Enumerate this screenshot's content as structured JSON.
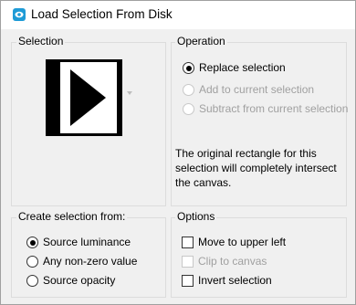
{
  "window": {
    "title": "Load Selection From Disk",
    "icon": "paintshop-app-icon"
  },
  "selection_group": {
    "label": "Selection",
    "thumbnail": "selection-preview-thumbnail"
  },
  "operation_group": {
    "label": "Operation",
    "options": [
      {
        "label": "Replace selection",
        "checked": true,
        "enabled": true
      },
      {
        "label": "Add to current selection",
        "checked": false,
        "enabled": false
      },
      {
        "label": "Subtract from current selection",
        "checked": false,
        "enabled": false
      }
    ],
    "info_text": "The original rectangle for this selection will completely intersect the canvas."
  },
  "create_group": {
    "label": "Create selection from:",
    "options": [
      {
        "label": "Source luminance",
        "checked": true
      },
      {
        "label": "Any non-zero value",
        "checked": false
      },
      {
        "label": "Source opacity",
        "checked": false
      }
    ]
  },
  "options_group": {
    "label": "Options",
    "items": [
      {
        "label": "Move to upper left",
        "checked": false,
        "enabled": true
      },
      {
        "label": "Clip to canvas",
        "checked": false,
        "enabled": false
      },
      {
        "label": "Invert selection",
        "checked": false,
        "enabled": true
      }
    ]
  },
  "colors": {
    "icon_teal": "#1e9bd6",
    "group_border": "#dcdcdc",
    "disabled_text": "#a0a0a0"
  }
}
